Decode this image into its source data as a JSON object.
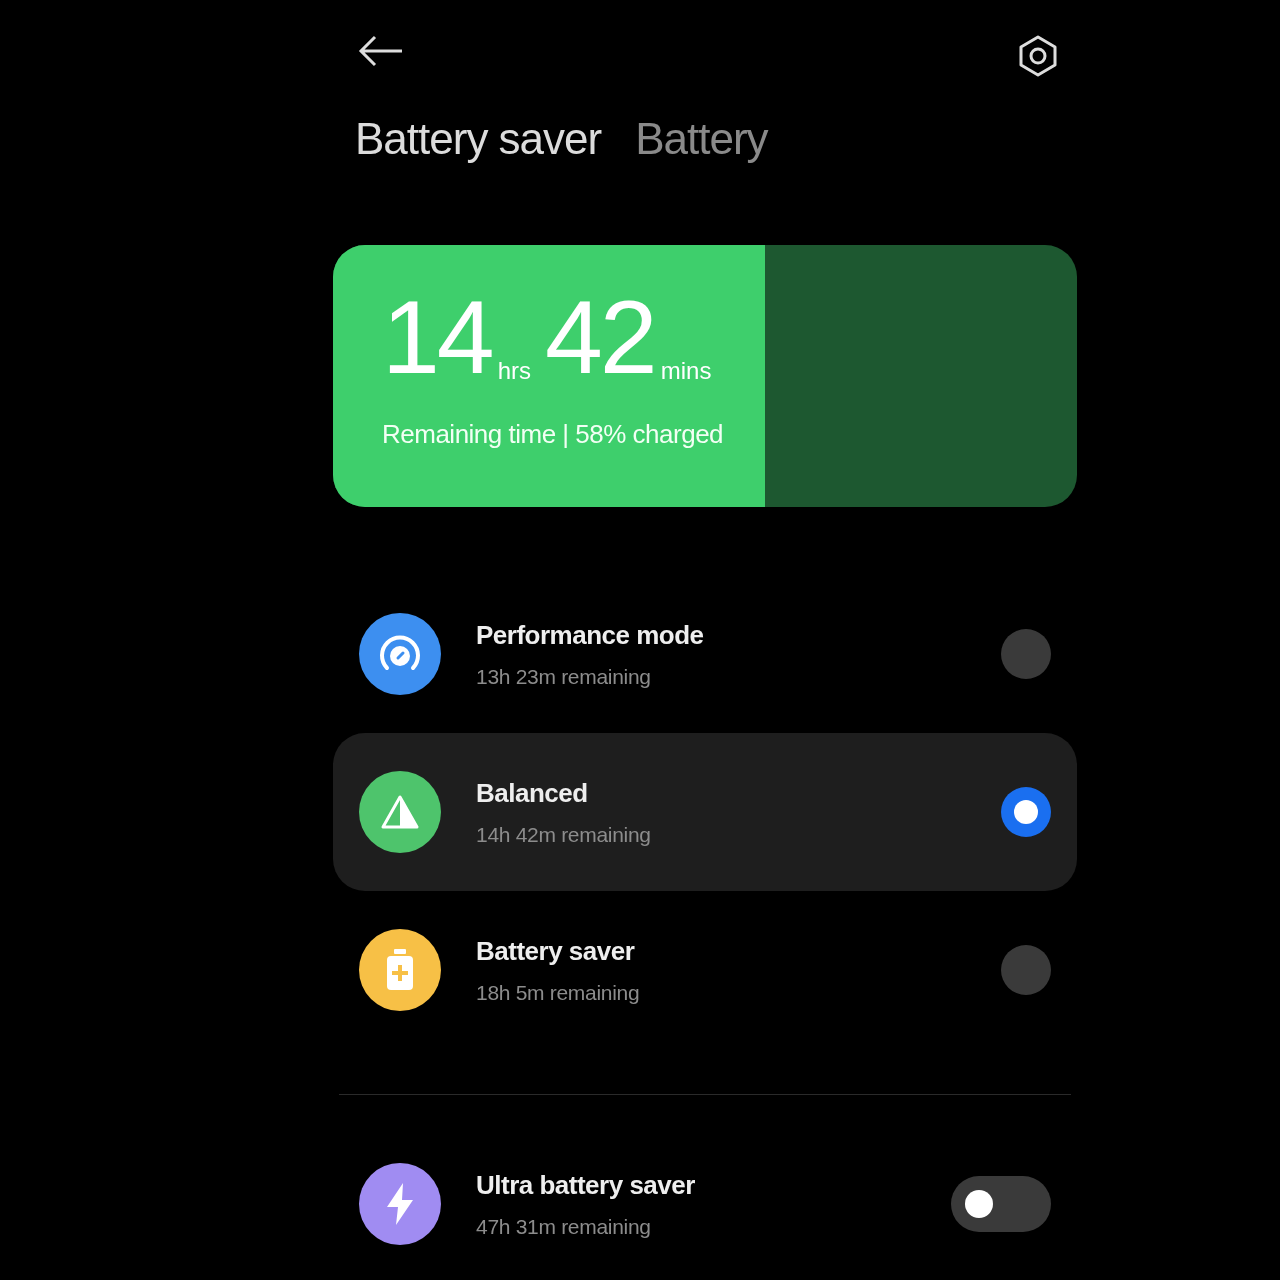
{
  "header": {
    "tabs": [
      {
        "label": "Battery saver",
        "selected": true
      },
      {
        "label": "Battery",
        "selected": false
      }
    ]
  },
  "battery": {
    "level": 0.58,
    "hours": "14",
    "hours_unit": "hrs",
    "minutes": "42",
    "minutes_unit": "mins",
    "caption": "Remaining time | 58% charged"
  },
  "modes": [
    {
      "kind": "gauge",
      "color": "#3d8ff0",
      "title": "Performance mode",
      "subtitle": "13h 23m remaining",
      "selected": false
    },
    {
      "kind": "balance",
      "color": "#4ec46c",
      "title": "Balanced",
      "subtitle": "14h 42m remaining",
      "selected": true
    },
    {
      "kind": "battery",
      "color": "#f7c046",
      "title": "Battery saver",
      "subtitle": "18h 5m remaining",
      "selected": false
    }
  ],
  "ultra": {
    "kind": "bolt",
    "color": "#a08cf2",
    "title": "Ultra battery saver",
    "subtitle": "47h 31m remaining",
    "on": false
  }
}
